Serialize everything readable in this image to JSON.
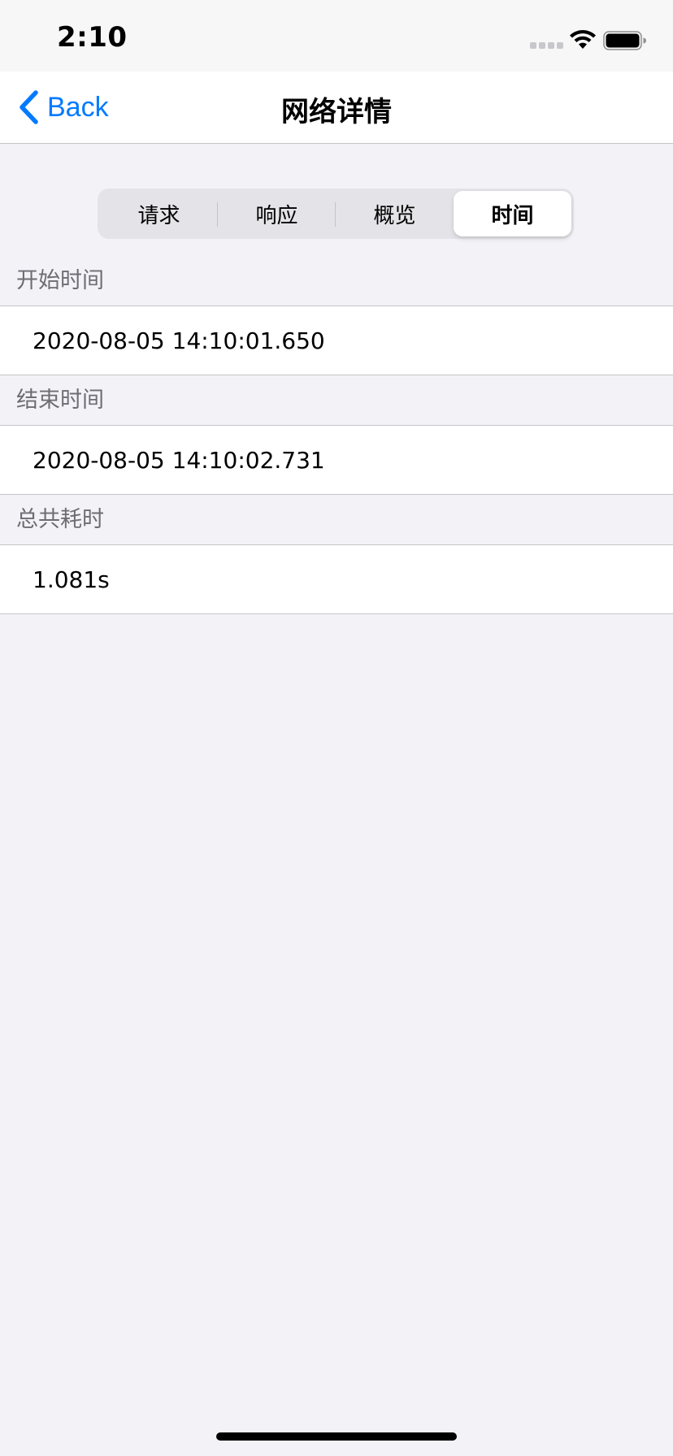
{
  "status_bar": {
    "time": "2:10",
    "wifi_icon": "wifi-icon",
    "battery_icon": "battery-icon"
  },
  "nav": {
    "back_label": "Back",
    "back_icon": "chevron-left-icon",
    "title": "网络详情",
    "accent_color": "#007aff"
  },
  "segments": {
    "items": [
      "请求",
      "响应",
      "概览",
      "时间"
    ],
    "selected": "时间"
  },
  "sections": [
    {
      "header": "开始时间",
      "value": "2020-08-05 14:10:01.650"
    },
    {
      "header": "结束时间",
      "value": "2020-08-05 14:10:02.731"
    },
    {
      "header": "总共耗时",
      "value": "1.081s"
    }
  ]
}
